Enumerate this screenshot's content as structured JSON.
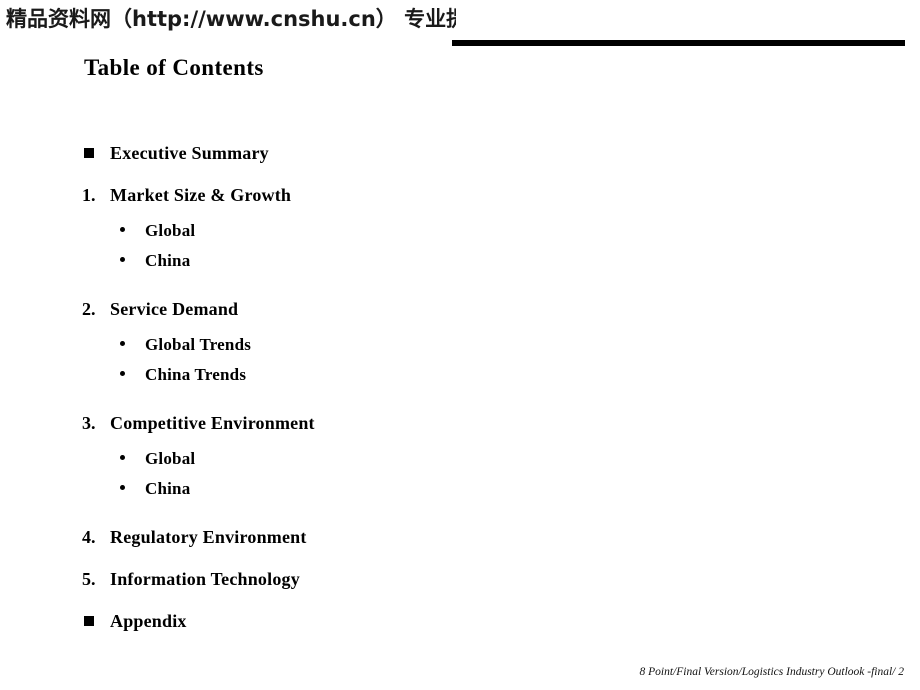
{
  "watermark": {
    "text": "精品资料网（http://www.cnshu.cn） 专业提供企管培训资料"
  },
  "header": {
    "title": "Table of Contents",
    "rule_color": "#000000"
  },
  "toc": {
    "items": [
      {
        "marker_type": "square",
        "marker": "",
        "label": "Executive Summary"
      },
      {
        "marker_type": "number",
        "marker": "1.",
        "label": "Market Size & Growth"
      },
      {
        "marker_type": "dot",
        "marker": "",
        "label": "Global"
      },
      {
        "marker_type": "dot",
        "marker": "",
        "label": "China"
      },
      {
        "marker_type": "number",
        "marker": "2.",
        "label": "Service Demand"
      },
      {
        "marker_type": "dot",
        "marker": "",
        "label": "Global Trends"
      },
      {
        "marker_type": "dot",
        "marker": "",
        "label": "China Trends"
      },
      {
        "marker_type": "number",
        "marker": "3.",
        "label": "Competitive Environment"
      },
      {
        "marker_type": "dot",
        "marker": "",
        "label": "Global"
      },
      {
        "marker_type": "dot",
        "marker": "",
        "label": "China"
      },
      {
        "marker_type": "number",
        "marker": "4.",
        "label": "Regulatory Environment"
      },
      {
        "marker_type": "number",
        "marker": "5.",
        "label": "Information Technology"
      },
      {
        "marker_type": "square",
        "marker": "",
        "label": "Appendix"
      }
    ]
  },
  "footer": {
    "text": "8 Point/Final Version/Logistics Industry Outlook -final/  2"
  }
}
